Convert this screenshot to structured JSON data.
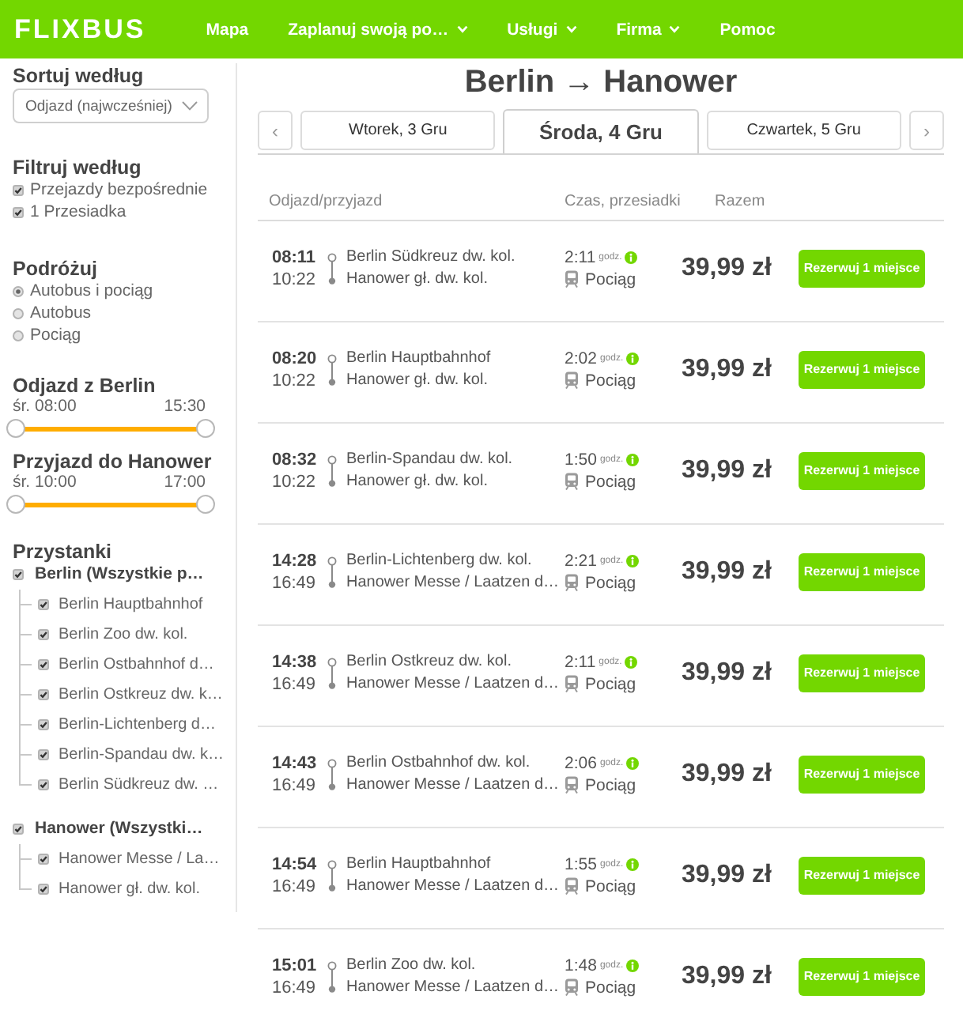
{
  "header": {
    "logo": "FLIXBUS",
    "nav": [
      {
        "label": "Mapa",
        "dropdown": false
      },
      {
        "label": "Zaplanuj swoją po…",
        "dropdown": true
      },
      {
        "label": "Usługi",
        "dropdown": true
      },
      {
        "label": "Firma",
        "dropdown": true
      },
      {
        "label": "Pomoc",
        "dropdown": false
      }
    ]
  },
  "sidebar": {
    "sort": {
      "heading": "Sortuj według",
      "value": "Odjazd (najwcześniej)"
    },
    "filter": {
      "heading": "Filtruj według",
      "options": [
        {
          "label": "Przejazdy bezpośrednie",
          "checked": true
        },
        {
          "label": "1 Przesiadka",
          "checked": true
        }
      ]
    },
    "travel": {
      "heading": "Podróżuj",
      "options": [
        {
          "label": "Autobus i pociąg",
          "selected": true
        },
        {
          "label": "Autobus",
          "selected": false
        },
        {
          "label": "Pociąg",
          "selected": false
        }
      ]
    },
    "time_ranges": [
      {
        "heading": "Odjazd z Berlin",
        "from": "śr. 08:00",
        "to": "15:30",
        "level": 1
      },
      {
        "heading": "Przyjazd do Hanower",
        "from": "śr. 10:00",
        "to": "17:00",
        "level": 1
      }
    ],
    "stops": {
      "heading": "Przystanki",
      "groups": [
        {
          "label": "Berlin (Wszystkie p…",
          "checked": true,
          "children": [
            {
              "label": "Berlin Hauptbahnhof",
              "checked": true
            },
            {
              "label": "Berlin Zoo dw. kol.",
              "checked": true
            },
            {
              "label": "Berlin Ostbahnhof d…",
              "checked": true
            },
            {
              "label": "Berlin Ostkreuz dw. k…",
              "checked": true
            },
            {
              "label": "Berlin-Lichtenberg d…",
              "checked": true
            },
            {
              "label": "Berlin-Spandau dw. k…",
              "checked": true
            },
            {
              "label": "Berlin Südkreuz dw. …",
              "checked": true
            }
          ]
        },
        {
          "label": "Hanower (Wszystki…",
          "checked": true,
          "children": [
            {
              "label": "Hanower Messe / La…",
              "checked": true
            },
            {
              "label": "Hanower gł. dw. kol.",
              "checked": true
            }
          ]
        }
      ]
    }
  },
  "results": {
    "title": "Berlin → Hanower",
    "prev": "‹",
    "next": "›",
    "date_tabs": [
      {
        "label": "Wtorek, 3 Gru",
        "selected": false
      },
      {
        "label": "Środa, 4 Gru",
        "selected": true
      },
      {
        "label": "Czwartek, 5 Gru",
        "selected": false
      }
    ],
    "columns": [
      "Odjazd/przyjazd",
      "Czas, przesiadki",
      "Razem"
    ],
    "rows": [
      {
        "departure": "08:11",
        "arrival": "10:22",
        "from": "Berlin Südkreuz dw. kol.",
        "to": "Hanower gł. dw. kol.",
        "duration": "2:11",
        "duration_unit": "godz.",
        "mode": "Pociąg",
        "price": "39,99 zł",
        "action": "Rezerwuj 1 miejsce"
      },
      {
        "departure": "08:20",
        "arrival": "10:22",
        "from": "Berlin Hauptbahnhof",
        "to": "Hanower gł. dw. kol.",
        "duration": "2:02",
        "duration_unit": "godz.",
        "mode": "Pociąg",
        "price": "39,99 zł",
        "action": "Rezerwuj 1 miejsce"
      },
      {
        "departure": "08:32",
        "arrival": "10:22",
        "from": "Berlin-Spandau dw. kol.",
        "to": "Hanower gł. dw. kol.",
        "duration": "1:50",
        "duration_unit": "godz.",
        "mode": "Pociąg",
        "price": "39,99 zł",
        "action": "Rezerwuj 1 miejsce"
      },
      {
        "departure": "14:28",
        "arrival": "16:49",
        "from": "Berlin-Lichtenberg dw. kol.",
        "to": "Hanower Messe / Laatzen d…",
        "duration": "2:21",
        "duration_unit": "godz.",
        "mode": "Pociąg",
        "price": "39,99 zł",
        "action": "Rezerwuj 1 miejsce"
      },
      {
        "departure": "14:38",
        "arrival": "16:49",
        "from": "Berlin Ostkreuz dw. kol.",
        "to": "Hanower Messe / Laatzen d…",
        "duration": "2:11",
        "duration_unit": "godz.",
        "mode": "Pociąg",
        "price": "39,99 zł",
        "action": "Rezerwuj 1 miejsce"
      },
      {
        "departure": "14:43",
        "arrival": "16:49",
        "from": "Berlin Ostbahnhof dw. kol.",
        "to": "Hanower Messe / Laatzen d…",
        "duration": "2:06",
        "duration_unit": "godz.",
        "mode": "Pociąg",
        "price": "39,99 zł",
        "action": "Rezerwuj 1 miejsce"
      },
      {
        "departure": "14:54",
        "arrival": "16:49",
        "from": "Berlin Hauptbahnhof",
        "to": "Hanower Messe / Laatzen d…",
        "duration": "1:55",
        "duration_unit": "godz.",
        "mode": "Pociąg",
        "price": "39,99 zł",
        "action": "Rezerwuj 1 miejsce"
      },
      {
        "departure": "15:01",
        "arrival": "16:49",
        "from": "Berlin Zoo dw. kol.",
        "to": "Hanower Messe / Laatzen d…",
        "duration": "1:48",
        "duration_unit": "godz.",
        "mode": "Pociąg",
        "price": "39,99 zł",
        "action": "Rezerwuj 1 miejsce"
      }
    ]
  }
}
